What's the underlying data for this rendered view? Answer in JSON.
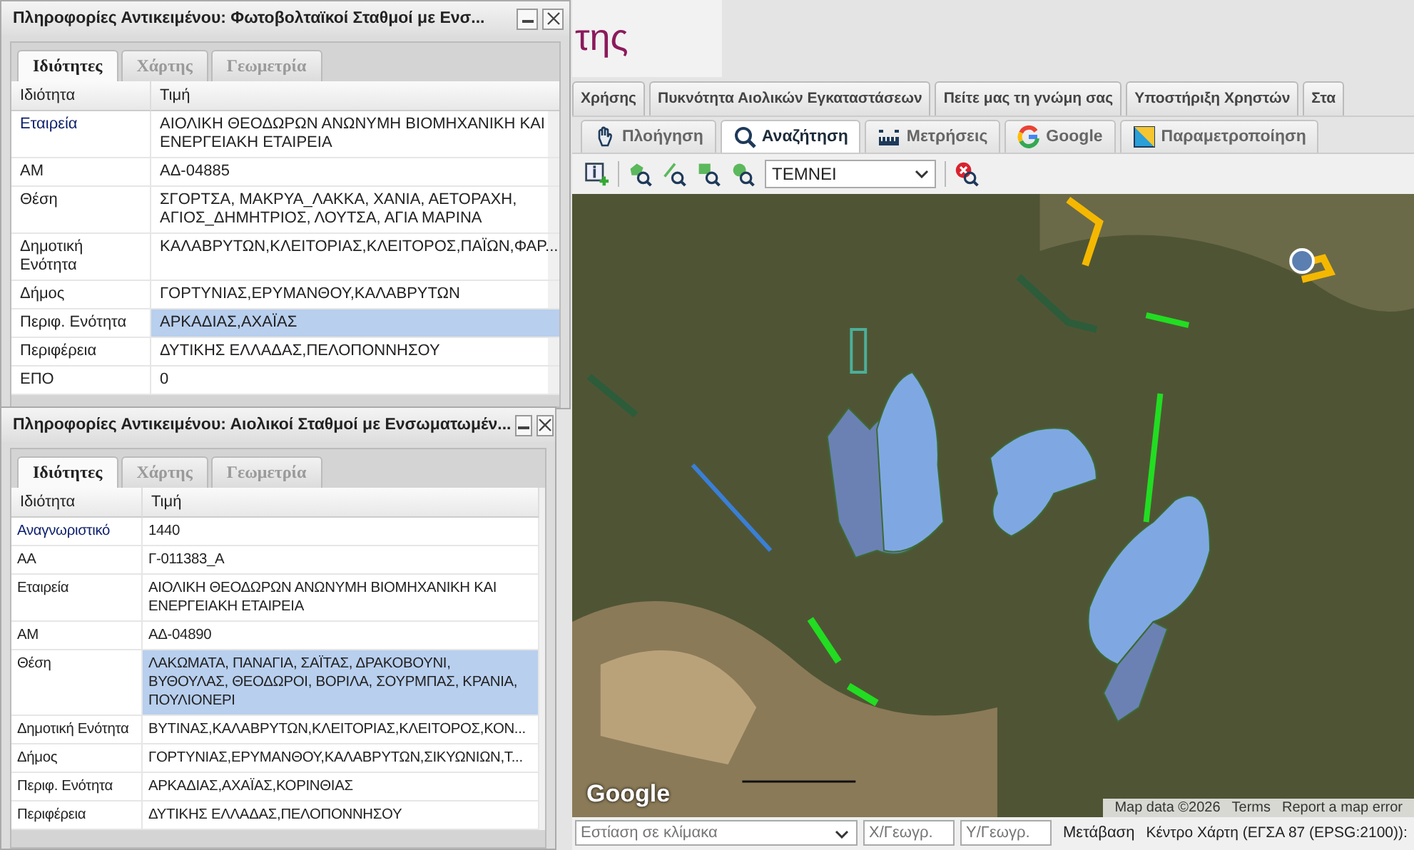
{
  "logo": {
    "text": "της"
  },
  "top_tabs": [
    {
      "label": "Χρήσης",
      "selected": false
    },
    {
      "label": "Πυκνότητα Αιολικών Εγκαταστάσεων",
      "selected": false
    },
    {
      "label": "Πείτε μας τη γνώμη σας",
      "selected": false
    },
    {
      "label": "Υποστήριξη Χρηστών",
      "selected": false
    },
    {
      "label": "Στα",
      "selected": false
    }
  ],
  "tool_tabs": [
    {
      "label": "Πλοήγηση",
      "selected": false
    },
    {
      "label": "Αναζήτηση",
      "selected": true
    },
    {
      "label": "Μετρήσεις",
      "selected": false
    },
    {
      "label": "Google",
      "selected": false
    },
    {
      "label": "Παραμετροποίηση",
      "selected": false
    }
  ],
  "toolbar": {
    "select_value": "ΤΕΜΝΕΙ"
  },
  "map": {
    "logo": "Google",
    "attribution": [
      "Map data ©2026",
      "Terms",
      "Report a map error"
    ]
  },
  "bottom_bar": {
    "scale_placeholder": "Εστίαση σε κλίμακα",
    "x_placeholder": "Χ/Γεωγρ.",
    "y_placeholder": "Υ/Γεωγρ.",
    "go_button": "Μετάβαση",
    "center_label": "Κέντρο Χάρτη (ΕΓΣΑ 87 (EPSG:2100)):"
  },
  "panels": [
    {
      "title": "Πληροφορίες Αντικειμένου: Φωτοβολταϊκοί Σταθμοί με Ενσ...",
      "tabs": [
        {
          "label": "Ιδιότητες",
          "selected": true
        },
        {
          "label": "Χάρτης",
          "selected": false
        },
        {
          "label": "Γεωμετρία",
          "selected": false
        }
      ],
      "columns": [
        "Ιδιότητα",
        "Τιμή"
      ],
      "rows": [
        {
          "property": "Εταιρεία",
          "value": "ΑΙΟΛΙΚΗ ΘΕΟΔΩΡΩΝ ΑΝΩΝΥΜΗ ΒΙΟΜΗΧΑΝΙΚΗ ΚΑΙ ΕΝΕΡΓΕΙΑΚΗ ΕΤΑΙΡΕΙΑ",
          "selected": false
        },
        {
          "property": "ΑΜ",
          "value": "ΑΔ-04885",
          "selected": false
        },
        {
          "property": "Θέση",
          "value": "ΣΓΟΡΤΣΑ, ΜΑΚΡΥΑ_ΛΑΚΚΑ, ΧΑΝΙΑ, ΑΕΤΟΡΑΧΗ, ΑΓΙΟΣ_ΔΗΜΗΤΡΙΟΣ, ΛΟΥΤΣΑ, ΑΓΙΑ ΜΑΡΙΝΑ",
          "selected": false
        },
        {
          "property": "Δημοτική Ενότητα",
          "value": "ΚΑΛΑΒΡΥΤΩΝ,ΚΛΕΙΤΟΡΙΑΣ,ΚΛΕΙΤΟΡΟΣ,ΠΑΪΩΝ,ΦΑΡ...",
          "selected": false
        },
        {
          "property": "Δήμος",
          "value": "ΓΟΡΤΥΝΙΑΣ,ΕΡΥΜΑΝΘΟΥ,ΚΑΛΑΒΡΥΤΩΝ",
          "selected": false
        },
        {
          "property": "Περιφ. Ενότητα",
          "value": "ΑΡΚΑΔΙΑΣ,ΑΧΑΪΑΣ",
          "selected": true
        },
        {
          "property": "Περιφέρεια",
          "value": "ΔΥΤΙΚΗΣ ΕΛΛΑΔΑΣ,ΠΕΛΟΠΟΝΝΗΣΟΥ",
          "selected": false
        },
        {
          "property": "ΕΠΟ",
          "value": "0",
          "selected": false
        }
      ]
    },
    {
      "title": "Πληροφορίες Αντικειμένου: Αιολικοί Σταθμοί με Ενσωματωμέν...",
      "tabs": [
        {
          "label": "Ιδιότητες",
          "selected": true
        },
        {
          "label": "Χάρτης",
          "selected": false
        },
        {
          "label": "Γεωμετρία",
          "selected": false
        }
      ],
      "columns": [
        "Ιδιότητα",
        "Τιμή"
      ],
      "rows": [
        {
          "property": "Αναγνωριστικό",
          "value": "1440",
          "selected": false
        },
        {
          "property": "ΑΑ",
          "value": "Γ-011383_Α",
          "selected": false
        },
        {
          "property": "Εταιρεία",
          "value": "ΑΙΟΛΙΚΗ ΘΕΟΔΩΡΩΝ ΑΝΩΝΥΜΗ ΒΙΟΜΗΧΑΝΙΚΗ ΚΑΙ ΕΝΕΡΓΕΙΑΚΗ ΕΤΑΙΡΕΙΑ",
          "selected": false
        },
        {
          "property": "ΑΜ",
          "value": "ΑΔ-04890",
          "selected": false
        },
        {
          "property": "Θέση",
          "value": "ΛΑΚΩΜΑΤΑ, ΠΑΝΑΓΙΑ, ΣΑΪΤΑΣ, ΔΡΑΚΟΒΟΥΝΙ, ΒΥΘΟΥΛΑΣ, ΘΕΟΔΩΡΟΙ, ΒΟΡΙΛΑ, ΣΟΥΡΜΠΑΣ, ΚΡΑΝΙΑ, ΠΟΥΛΙΟΝΕΡΙ",
          "selected": true
        },
        {
          "property": "Δημοτική Ενότητα",
          "value": "ΒΥΤΙΝΑΣ,ΚΑΛΑΒΡΥΤΩΝ,ΚΛΕΙΤΟΡΙΑΣ,ΚΛΕΙΤΟΡΟΣ,ΚΟΝ...",
          "selected": false
        },
        {
          "property": "Δήμος",
          "value": "ΓΟΡΤΥΝΙΑΣ,ΕΡΥΜΑΝΘΟΥ,ΚΑΛΑΒΡΥΤΩΝ,ΣΙΚΥΩΝΙΩΝ,Τ...",
          "selected": false
        },
        {
          "property": "Περιφ. Ενότητα",
          "value": "ΑΡΚΑΔΙΑΣ,ΑΧΑΪΑΣ,ΚΟΡΙΝΘΙΑΣ",
          "selected": false
        },
        {
          "property": "Περιφέρεια",
          "value": "ΔΥΤΙΚΗΣ ΕΛΛΑΔΑΣ,ΠΕΛΟΠΟΝΝΗΣΟΥ",
          "selected": false
        }
      ]
    }
  ]
}
